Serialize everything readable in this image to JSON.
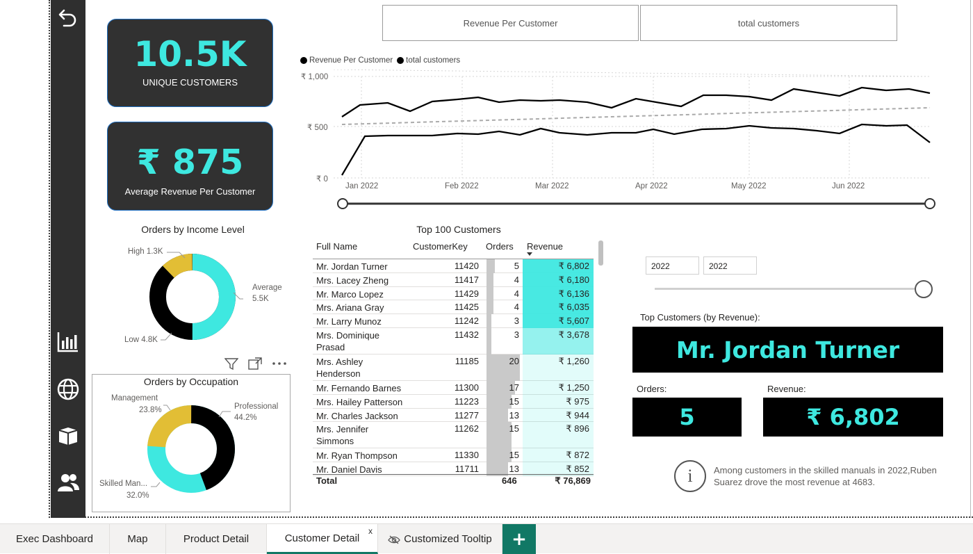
{
  "kpis": {
    "unique_customers": {
      "value": "10.5K",
      "label": "UNIQUE CUSTOMERS"
    },
    "avg_revenue": {
      "value": "₹ 875",
      "label": "Average Revenue Per Customer"
    }
  },
  "toggle_buttons": {
    "left": "Revenue Per Customer",
    "right": "total customers"
  },
  "line_chart": {
    "legend": [
      "Revenue Per Customer",
      "total customers"
    ],
    "y_ticks": [
      "₹ 1,000",
      "₹ 500",
      "₹ 0"
    ],
    "x_ticks": [
      "Jan 2022",
      "Feb 2022",
      "Mar 2022",
      "Apr 2022",
      "May 2022",
      "Jun 2022"
    ]
  },
  "income_donut": {
    "title": "Orders by Income Level",
    "high_label": "High 1.3K",
    "avg_label_1": "Average",
    "avg_label_2": "5.5K",
    "low_label": "Low 4.8K"
  },
  "occupation_donut": {
    "title": "Orders by Occupation",
    "mgmt_label_1": "Management",
    "mgmt_label_2": "23.8%",
    "prof_label_1": "Professional",
    "prof_label_2": "44.2%",
    "skill_label_1": "Skilled Man...",
    "skill_label_2": "32.0%"
  },
  "table": {
    "title": "Top 100 Customers",
    "headers": {
      "name": "Full Name",
      "key": "CustomerKey",
      "orders": "Orders",
      "revenue": "Revenue"
    },
    "rows": [
      {
        "name1": "Mr. Jordan Turner",
        "name2": "",
        "key": "11420",
        "orders": "5",
        "revenue": "₹ 6,802"
      },
      {
        "name1": "Mrs. Lacey Zheng",
        "name2": "",
        "key": "11417",
        "orders": "4",
        "revenue": "₹ 6,180"
      },
      {
        "name1": "Mr. Marco Lopez",
        "name2": "",
        "key": "11429",
        "orders": "4",
        "revenue": "₹ 6,136"
      },
      {
        "name1": "Mrs. Ariana Gray",
        "name2": "",
        "key": "11425",
        "orders": "4",
        "revenue": "₹ 6,035"
      },
      {
        "name1": "Mr. Larry Munoz",
        "name2": "",
        "key": "11242",
        "orders": "3",
        "revenue": "₹ 5,607"
      },
      {
        "name1": "Mrs. Dominique",
        "name2": "Prasad",
        "key": "11432",
        "orders": "3",
        "revenue": "₹ 3,678"
      },
      {
        "name1": "Mrs. Ashley",
        "name2": "Henderson",
        "key": "11185",
        "orders": "20",
        "revenue": "₹ 1,260"
      },
      {
        "name1": "Mr. Fernando Barnes",
        "name2": "",
        "key": "11300",
        "orders": "17",
        "revenue": "₹ 1,250"
      },
      {
        "name1": "Mrs. Hailey Patterson",
        "name2": "",
        "key": "11223",
        "orders": "15",
        "revenue": "₹ 975"
      },
      {
        "name1": "Mr. Charles Jackson",
        "name2": "",
        "key": "11277",
        "orders": "13",
        "revenue": "₹ 944"
      },
      {
        "name1": "Mrs. Jennifer",
        "name2": "Simmons",
        "key": "11262",
        "orders": "15",
        "revenue": "₹ 896"
      },
      {
        "name1": "Mr. Ryan Thompson",
        "name2": "",
        "key": "11330",
        "orders": "15",
        "revenue": "₹ 872"
      },
      {
        "name1": "Mr. Daniel Davis",
        "name2": "",
        "key": "11711",
        "orders": "13",
        "revenue": "₹ 852"
      }
    ],
    "total_label": "Total",
    "total_orders": "646",
    "total_revenue": "₹ 76,869"
  },
  "year_filter": {
    "from": "2022",
    "to": "2022"
  },
  "top_customer": {
    "heading": "Top Customers (by Revenue):",
    "name": "Mr. Jordan Turner",
    "orders_label": "Orders:",
    "orders_value": "5",
    "revenue_label": "Revenue:",
    "revenue_value": "₹ 6,802"
  },
  "insight": "Among customers in the skilled manuals in 2022,Ruben Suarez drove the most revenue at 4683.",
  "page_tabs": [
    "Exec Dashboard",
    "Map",
    "Product Detail",
    "Customer Detail",
    "Customized Tooltip"
  ],
  "active_tab_close": "x",
  "add_page": "+",
  "colors": {
    "accent": "#3ee8e0",
    "dark_card": "#313131",
    "gold": "#e2be35",
    "active_tab": "#117865"
  }
}
